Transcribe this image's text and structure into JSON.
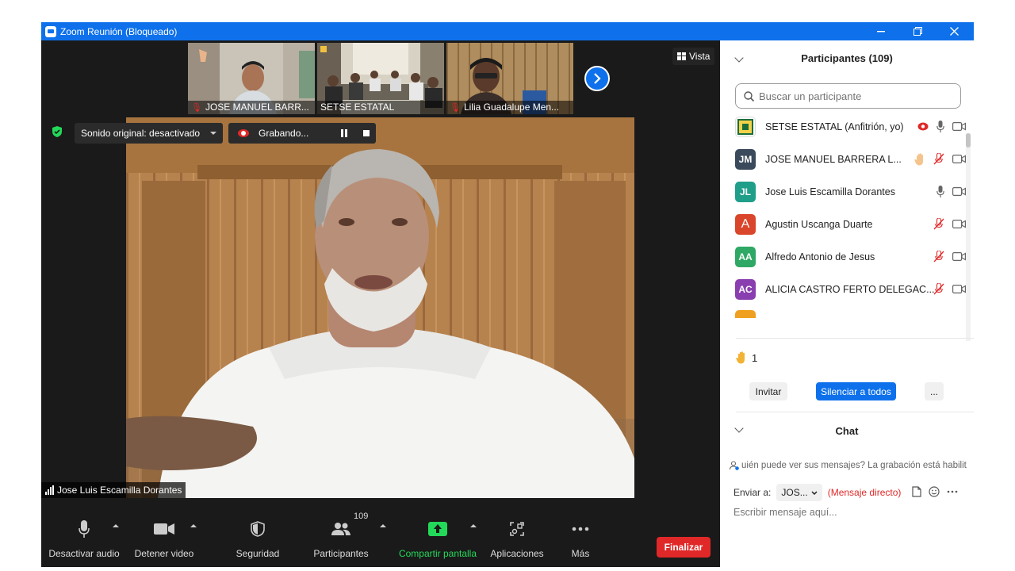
{
  "window": {
    "title": "Zoom Reunión (Bloqueado)",
    "controls": [
      "minimize",
      "restore",
      "close"
    ]
  },
  "top_bar": {
    "view_label": "Vista",
    "thumbnails": [
      {
        "name": "JOSE MANUEL BARR...",
        "muted": true
      },
      {
        "name": "SETSE ESTATAL",
        "muted": false
      },
      {
        "name": "Lilia Guadalupe Men...",
        "muted": true
      }
    ]
  },
  "status": {
    "original_sound": "Sonido original: desactivado",
    "recording": "Grabando..."
  },
  "main_video": {
    "speaker_name": "Jose Luis Escamilla Dorantes"
  },
  "toolbar": {
    "audio": "Desactivar audio",
    "video": "Detener video",
    "security": "Seguridad",
    "participants": "Participantes",
    "participants_count": "109",
    "share": "Compartir pantalla",
    "apps": "Aplicaciones",
    "more": "Más",
    "end": "Finalizar"
  },
  "participants_panel": {
    "title": "Participantes (109)",
    "search_placeholder": "Buscar un participante",
    "participants": [
      {
        "initials": "",
        "name": "SETSE ESTATAL (Anfitrión, yo)",
        "color": "#ffffff",
        "recording": true,
        "hand": false,
        "muted": false
      },
      {
        "initials": "JM",
        "name": "JOSE MANUEL BARRERA L...",
        "color": "#3a4a5c",
        "recording": false,
        "hand": true,
        "muted": true
      },
      {
        "initials": "JL",
        "name": "Jose Luis Escamilla Dorantes",
        "color": "#1f9e8a",
        "recording": false,
        "hand": false,
        "muted": false
      },
      {
        "initials": "A",
        "name": "Agustin Uscanga Duarte",
        "color": "#d9462b",
        "recording": false,
        "hand": false,
        "muted": true
      },
      {
        "initials": "AA",
        "name": "Alfredo Antonio de Jesus",
        "color": "#2ea864",
        "recording": false,
        "hand": false,
        "muted": true
      },
      {
        "initials": "AC",
        "name": "ALICIA CASTRO FERTO DELEGAC...",
        "color": "#8a3fb0",
        "recording": false,
        "hand": false,
        "muted": true
      }
    ],
    "raised_hands": "1",
    "invite": "Invitar",
    "mute_all": "Silenciar a todos",
    "more": "..."
  },
  "chat": {
    "title": "Chat",
    "notice": "uién puede ver sus mensajes? La grabación está habilit",
    "send_to_label": "Enviar a:",
    "send_to_value": "JOS...",
    "direct_message": "(Mensaje directo)",
    "input_placeholder": "Escribir mensaje aquí..."
  },
  "colors": {
    "zoom_blue": "#0e71eb",
    "end_red": "#e02828",
    "share_green": "#23d959",
    "dark_bg": "#1a1a1a"
  }
}
